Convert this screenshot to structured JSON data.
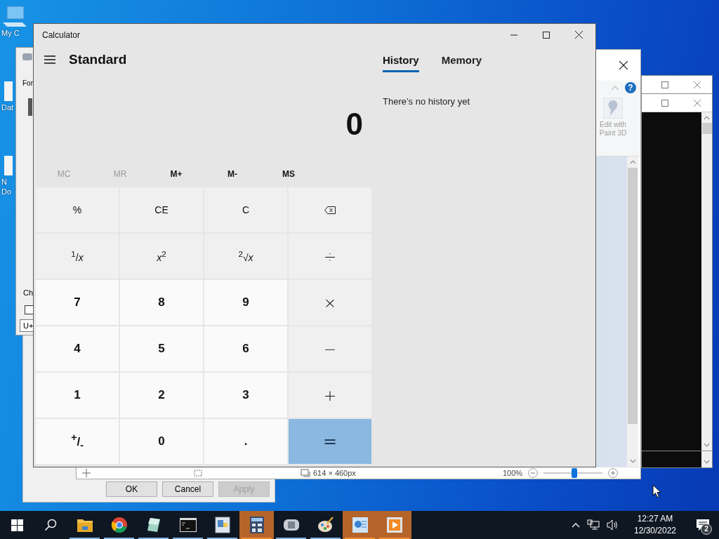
{
  "desktop": {
    "icons": [
      {
        "kind": "computer",
        "lines": [
          "My C"
        ]
      },
      {
        "kind": "file",
        "lines": [
          "Dat"
        ]
      },
      {
        "kind": "file",
        "lines": [
          "N",
          "Do"
        ]
      }
    ]
  },
  "char_map": {
    "labels": [
      "For",
      "Ch"
    ],
    "checkbox": {
      "checked": false
    },
    "code_field": {
      "value": "U+"
    }
  },
  "properties_dialog": {
    "buttons": [
      {
        "label": "OK",
        "disabled": false
      },
      {
        "label": "Cancel",
        "disabled": false
      },
      {
        "label": "Apply",
        "disabled": true
      }
    ]
  },
  "paint": {
    "help_button": "?",
    "ribbon_button": "Edit with Paint 3D",
    "image_size": "614 × 460px",
    "zoom": "100%",
    "zoom_slider": {
      "level": 0.52
    }
  },
  "calculator": {
    "title": "Calculator",
    "mode": "Standard",
    "display": "0",
    "tabs": [
      {
        "label": "History",
        "selected": true
      },
      {
        "label": "Memory",
        "selected": false
      }
    ],
    "history_message": "There’s no history yet",
    "memory_buttons": [
      {
        "label": "MC",
        "disabled": true
      },
      {
        "label": "MR",
        "disabled": true
      },
      {
        "label": "M+",
        "disabled": false
      },
      {
        "label": "M-",
        "disabled": false
      },
      {
        "label": "MS",
        "disabled": false
      }
    ],
    "keys": [
      {
        "label": "%",
        "kind": "function"
      },
      {
        "label": "CE",
        "kind": "function"
      },
      {
        "label": "C",
        "kind": "function"
      },
      {
        "kind": "backspace"
      },
      {
        "label": "$^{1}$/*x*",
        "kind": "function"
      },
      {
        "label": "*x*$^{2}$",
        "kind": "function"
      },
      {
        "label": "$^{2}$√*x*",
        "kind": "function"
      },
      {
        "label": "÷",
        "kind": "operator"
      },
      {
        "label": "7",
        "kind": "digit"
      },
      {
        "label": "8",
        "kind": "digit"
      },
      {
        "label": "9",
        "kind": "digit"
      },
      {
        "label": "×",
        "kind": "operator"
      },
      {
        "label": "4",
        "kind": "digit"
      },
      {
        "label": "5",
        "kind": "digit"
      },
      {
        "label": "6",
        "kind": "digit"
      },
      {
        "label": "−",
        "kind": "operator"
      },
      {
        "label": "1",
        "kind": "digit"
      },
      {
        "label": "2",
        "kind": "digit"
      },
      {
        "label": "3",
        "kind": "digit"
      },
      {
        "label": "+",
        "kind": "operator"
      },
      {
        "label": "$^{+}$/$_{-}$",
        "kind": "digit"
      },
      {
        "label": "0",
        "kind": "digit"
      },
      {
        "label": ".",
        "kind": "digit"
      },
      {
        "label": "=",
        "kind": "equals"
      }
    ]
  },
  "taskbar": {
    "apps": [
      {
        "kind": "folder",
        "highlighted": false,
        "running": true
      },
      {
        "kind": "browser",
        "highlighted": false,
        "running": true
      },
      {
        "kind": "glass",
        "highlighted": false,
        "running": true
      },
      {
        "kind": "terminal",
        "highlighted": false,
        "running": true
      },
      {
        "kind": "document",
        "highlighted": false,
        "running": true
      },
      {
        "kind": "calculator",
        "highlighted": true,
        "running": true
      },
      {
        "kind": "charmap",
        "highlighted": false,
        "running": true
      },
      {
        "kind": "paint",
        "highlighted": false,
        "running": true
      },
      {
        "kind": "chart",
        "highlighted": true,
        "running": true
      },
      {
        "kind": "media",
        "highlighted": true,
        "running": true
      }
    ],
    "time": "12:27 AM",
    "date": "12/30/2022",
    "notifications": "2"
  }
}
